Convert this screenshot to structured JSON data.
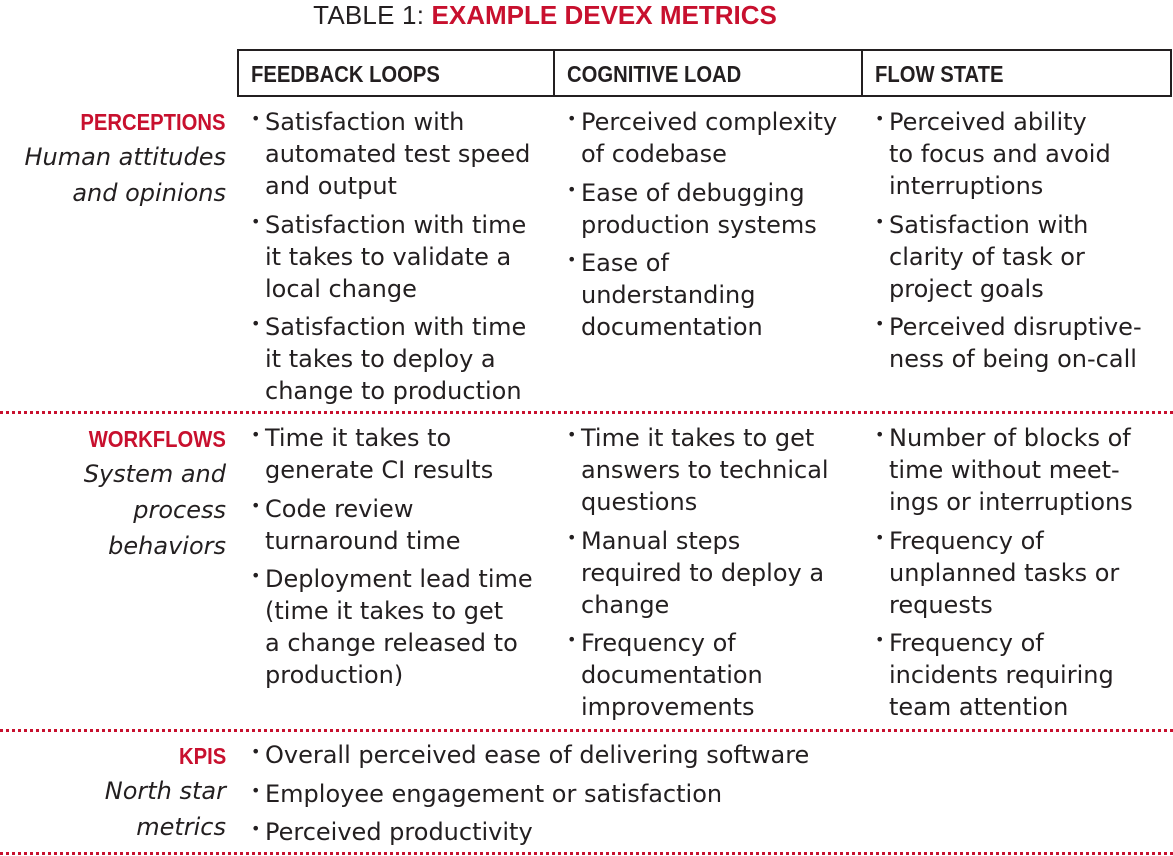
{
  "title": {
    "prefix": "TABLE 1: ",
    "accent": "EXAMPLE DEVEX METRICS"
  },
  "columns": [
    "FEEDBACK LOOPS",
    "COGNITIVE LOAD",
    "FLOW STATE"
  ],
  "rows": [
    {
      "category": "PERCEPTIONS",
      "subtitle": "Human attitudes\nand opinions",
      "cells": [
        [
          "Satisfaction with\nautomated test  speed\nand output",
          "Satisfaction with time\nit takes to validate a\nlocal change",
          "Satisfaction with time\nit takes to deploy a\nchange to production"
        ],
        [
          "Perceived complexity\nof codebase",
          "Ease of debugging\nproduction systems",
          "Ease of\nunderstanding\ndocumentation"
        ],
        [
          "Perceived ability\nto focus and avoid\ninterruptions",
          "Satisfaction with\nclarity of task or\nproject goals",
          "Perceived disruptive-\nness of being on-call"
        ]
      ]
    },
    {
      "category": "WORKFLOWS",
      "subtitle": "System and\nprocess\nbehaviors",
      "cells": [
        [
          "Time it takes to\ngenerate CI results",
          "Code review\nturnaround time",
          "Deployment lead time\n(time it takes to get\na change released to\nproduction)"
        ],
        [
          "Time it takes to get\nanswers to technical\nquestions",
          "Manual steps\nrequired to deploy a\nchange",
          "Frequency of\ndocumentation\nimprovements"
        ],
        [
          "Number of blocks of\ntime without meet-\nings or interruptions",
          "Frequency of\nunplanned tasks or\nrequests",
          "Frequency of\nincidents requiring\nteam attention"
        ]
      ]
    },
    {
      "category": "KPIS",
      "subtitle": "North star\nmetrics",
      "items": [
        "Overall perceived ease of delivering software",
        "Employee engagement or satisfaction",
        "Perceived productivity"
      ]
    }
  ],
  "colors": {
    "accent": "#c8102e",
    "text": "#231f20"
  }
}
